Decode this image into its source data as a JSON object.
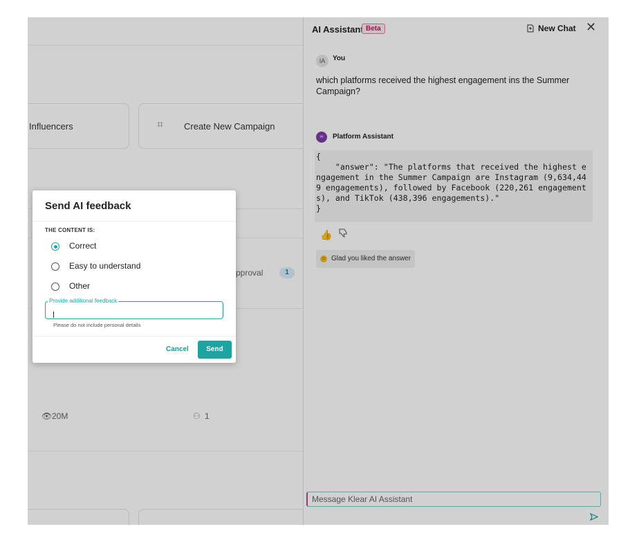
{
  "background": {
    "cards": {
      "influencers_label": "Influencers",
      "create_campaign_label": "Create New Campaign",
      "approval_label": "pproval",
      "approval_count": "1",
      "views_label": "20M",
      "members_label": "1"
    }
  },
  "assistant": {
    "title": "AI Assistant",
    "beta_badge": "Beta",
    "new_chat_label": "New Chat",
    "user_initials": "IA",
    "user_name": "You",
    "question": "which platforms received the highest engagement ins the Summer Campaign?",
    "bot_name": "Platform Assistant",
    "answer_code": "{\n    \"answer\": \"The platforms that received the highest e\nngagement in the Summer Campaign are Instagram (9,634,44\n9 engagements), followed by Facebook (220,261 engagement\ns), and TikTok (438,396 engagements).\"\n}",
    "feedback_ack": "Glad you liked the answer",
    "input_placeholder": "Message Klear AI Assistant"
  },
  "modal": {
    "title": "Send AI feedback",
    "section_label": "THE CONTENT IS:",
    "options": [
      {
        "label": "Correct",
        "selected": true
      },
      {
        "label": "Easy to understand",
        "selected": false
      },
      {
        "label": "Other",
        "selected": false
      }
    ],
    "feedback_legend": "Provide additional feedback",
    "helper_text": "Please do not include personal details",
    "cancel_label": "Cancel",
    "send_label": "Send"
  },
  "colors": {
    "accent": "#1ea3a0",
    "beta": "#c2185b",
    "overlay": "rgba(0,0,0,0.18)"
  }
}
